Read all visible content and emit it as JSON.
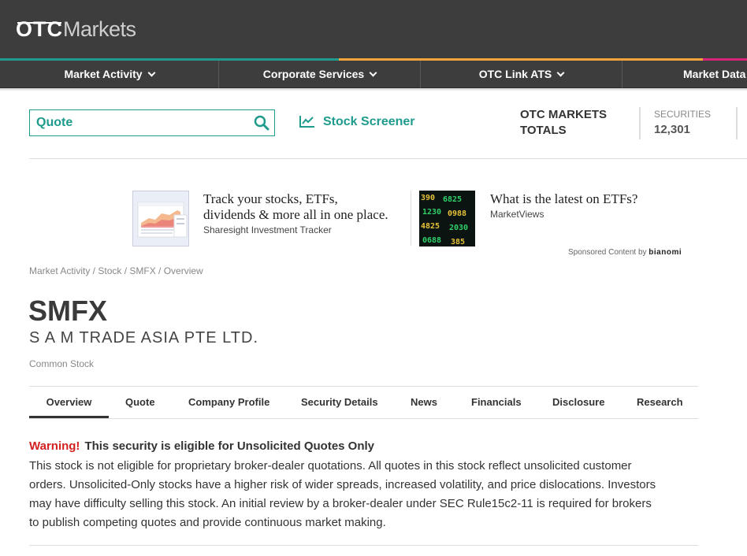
{
  "header": {
    "logo_otc": "OTC",
    "logo_markets": "Markets"
  },
  "nav": {
    "items": [
      {
        "label": "Market Activity"
      },
      {
        "label": "Corporate Services"
      },
      {
        "label": "OTC Link ATS"
      },
      {
        "label": "Market Data"
      }
    ]
  },
  "search": {
    "placeholder": "Quote"
  },
  "screener": {
    "label": "Stock Screener"
  },
  "totals": {
    "title_line1": "OTC MARKETS",
    "title_line2": "TOTALS",
    "securities_label": "SECURITIES",
    "securities_value": "12,301"
  },
  "ads": [
    {
      "title_line1": "Track your stocks, ETFs,",
      "title_line2": "dividends & more all in one place.",
      "source": "Sharesight Investment Tracker"
    },
    {
      "title_line1": "What is the latest on ETFs?",
      "source": "MarketViews"
    }
  ],
  "sponsored": {
    "text": "Sponsored Content by",
    "brand": "bianomi"
  },
  "breadcrumb": "Market Activity / Stock / SMFX / Overview",
  "security": {
    "ticker": "SMFX",
    "company": "S A M TRADE ASIA PTE LTD.",
    "type": "Common Stock"
  },
  "tabs": [
    {
      "label": "Overview"
    },
    {
      "label": "Quote"
    },
    {
      "label": "Company Profile"
    },
    {
      "label": "Security Details"
    },
    {
      "label": "News"
    },
    {
      "label": "Financials"
    },
    {
      "label": "Disclosure"
    },
    {
      "label": "Research"
    }
  ],
  "warning": {
    "label": "Warning!",
    "title": "This security is eligible for Unsolicited Quotes Only",
    "body": "This stock is not eligible for proprietary broker-dealer quotations. All quotes in this stock reflect unsolicited customer orders. Unsolicited-Only stocks have a higher risk of wider spreads, increased volatility, and price dislocations. Investors may have difficulty selling this stock. An initial review by a broker-dealer under SEC Rule15c2-11 is required for brokers to publish competing quotes and provide continuous market making."
  },
  "colors": {
    "accent": "#1f9b8d",
    "header_bg": "#3d3d3d",
    "warning_red": "#d32020"
  }
}
